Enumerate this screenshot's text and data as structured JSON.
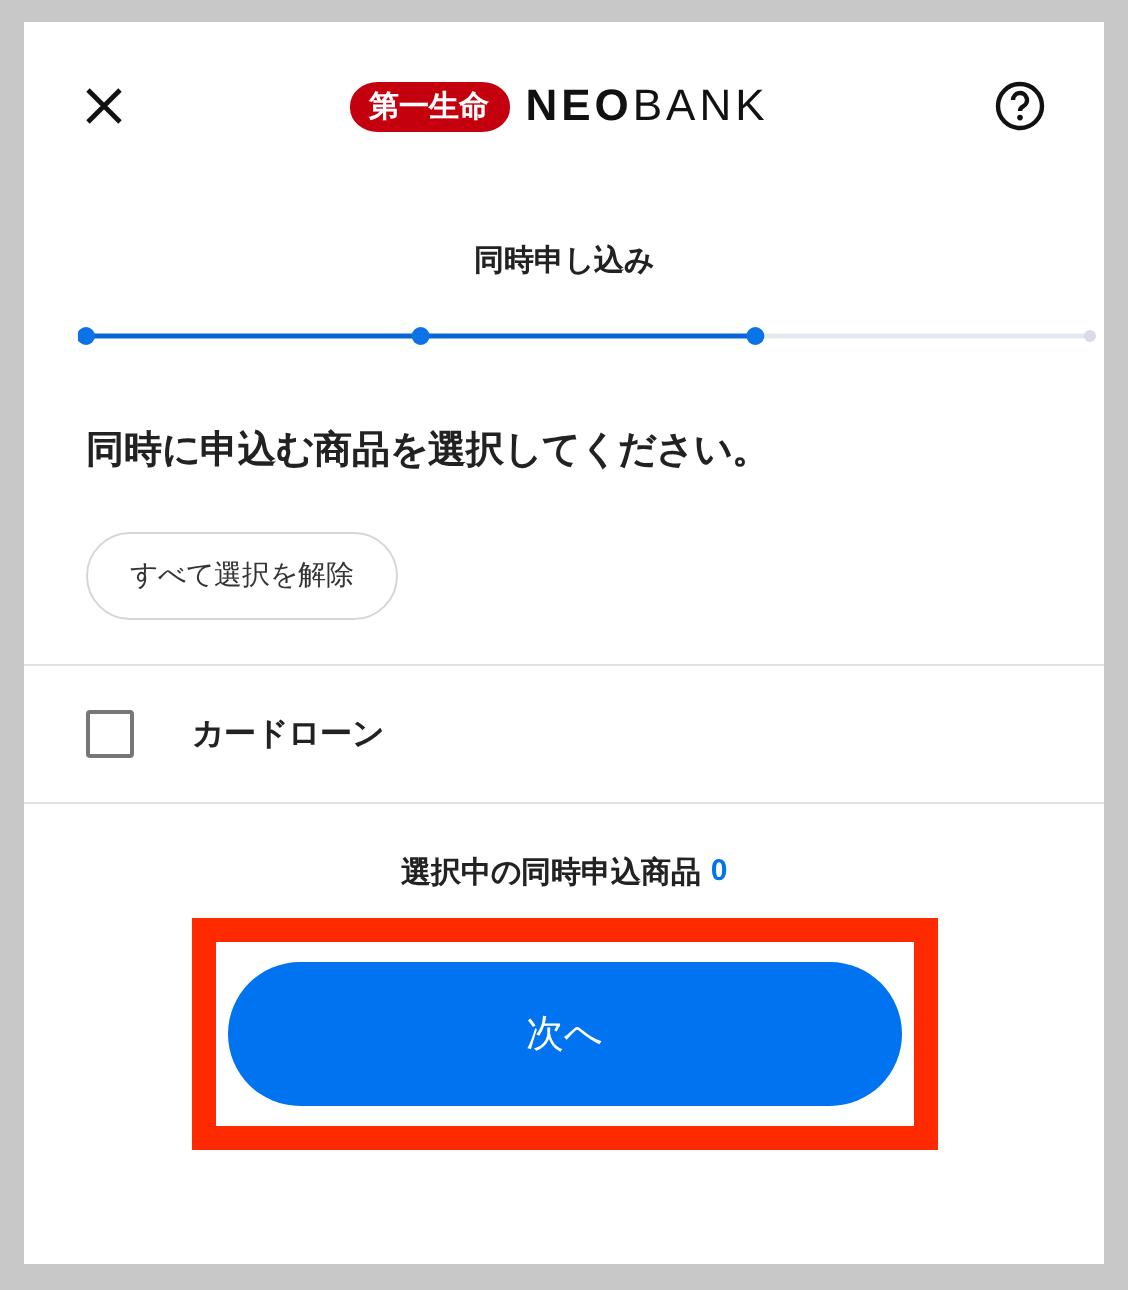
{
  "header": {
    "logo_badge": "第一生命",
    "logo_bold": "NEO",
    "logo_light": "BANK"
  },
  "title": "同時申し込み",
  "steps": [
    {
      "done": true
    },
    {
      "done": true
    },
    {
      "done": true
    },
    {
      "done": false
    }
  ],
  "heading": "同時に申込む商品を選択してください。",
  "clear_button": "すべて選択を解除",
  "products": [
    {
      "label": "カードローン",
      "checked": false
    }
  ],
  "summary": {
    "label": "選択中の同時申込商品",
    "count": "0"
  },
  "next_button": {
    "label": "次へ",
    "highlighted": true
  }
}
